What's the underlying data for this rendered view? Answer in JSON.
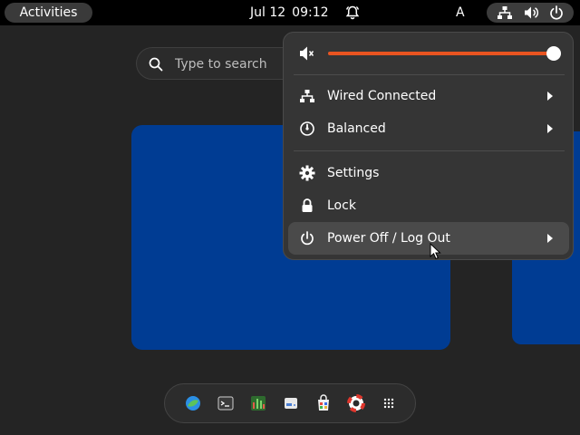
{
  "topbar": {
    "activities_label": "Activities",
    "date": "Jul 12",
    "time": "09:12",
    "input_source": "A",
    "icons": [
      "notification-bell-icon",
      "network-wired-icon",
      "volume-icon",
      "power-icon"
    ]
  },
  "search": {
    "placeholder": "Type to search"
  },
  "system_menu": {
    "volume": {
      "level": 0.98,
      "icon": "volume-muted-icon",
      "accent": "#e95420"
    },
    "items": [
      {
        "label": "Wired Connected",
        "icon": "network-wired-icon",
        "submenu": true
      },
      {
        "label": "Balanced",
        "icon": "power-profile-icon",
        "submenu": true
      },
      {
        "label": "Settings",
        "icon": "gear-icon",
        "submenu": false
      },
      {
        "label": "Lock",
        "icon": "lock-icon",
        "submenu": false
      },
      {
        "label": "Power Off / Log Out",
        "icon": "power-icon",
        "submenu": true,
        "highlighted": true
      }
    ]
  },
  "dash": {
    "apps": [
      "browser-icon",
      "terminal-icon",
      "system-monitor-icon",
      "disk-utility-icon",
      "software-installer-icon",
      "help-icon",
      "show-apps-icon"
    ]
  },
  "colors": {
    "workspace": "#003c93",
    "topbar": "#000000",
    "menu_bg": "#353535",
    "accent": "#e95420"
  }
}
